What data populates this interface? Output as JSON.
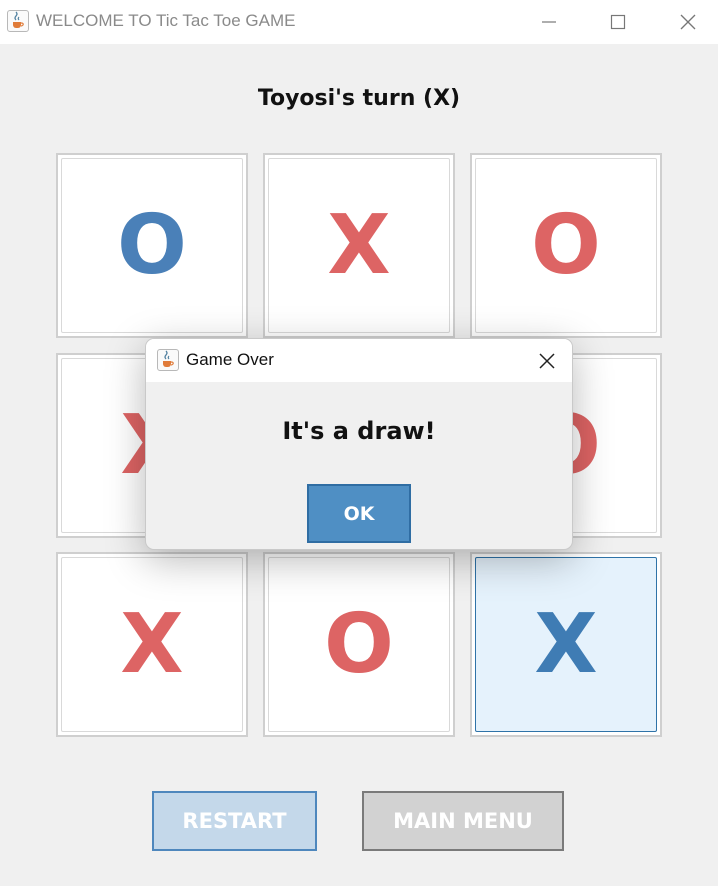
{
  "window": {
    "title": "WELCOME TO Tic Tac Toe GAME",
    "icon": "java-cup-icon"
  },
  "game": {
    "status": "Toyosi's turn (X)",
    "colors": {
      "x": "#dd6464",
      "o": "#dd6464",
      "last_move": "#3f7cb4",
      "first_o": "#4a80b8"
    },
    "board": [
      {
        "mark": "O",
        "color": "#4a80b8",
        "active": false
      },
      {
        "mark": "X",
        "color": "#dd6464",
        "active": false
      },
      {
        "mark": "O",
        "color": "#dd6464",
        "active": false
      },
      {
        "mark": "X",
        "color": "#dd6464",
        "active": false
      },
      {
        "mark": "",
        "color": "#dd6464",
        "active": false
      },
      {
        "mark": "O",
        "color": "#dd6464",
        "active": false
      },
      {
        "mark": "X",
        "color": "#dd6464",
        "active": false
      },
      {
        "mark": "O",
        "color": "#dd6464",
        "active": false
      },
      {
        "mark": "X",
        "color": "#3f7cb4",
        "active": true
      }
    ]
  },
  "buttons": {
    "restart": "RESTART",
    "main_menu": "MAIN MENU"
  },
  "dialog": {
    "title": "Game Over",
    "message": "It's a draw!",
    "ok": "OK"
  }
}
